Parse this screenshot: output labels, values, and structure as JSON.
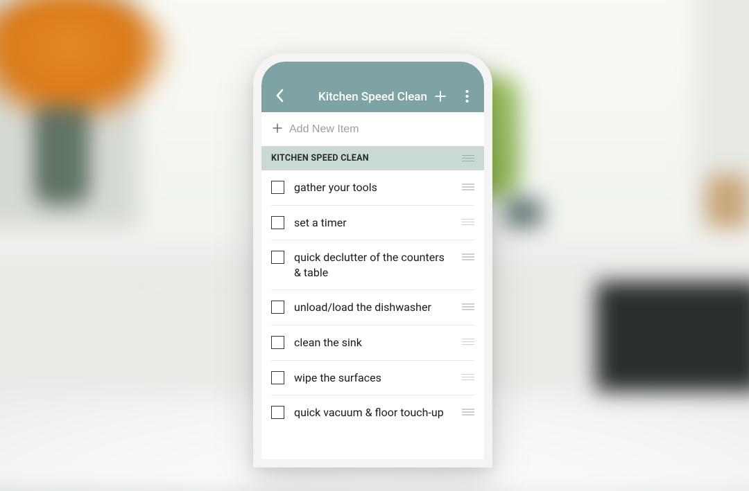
{
  "header": {
    "title": "Kitchen Speed Clean"
  },
  "addItem": {
    "placeholder": "Add New Item"
  },
  "section": {
    "title": "KITCHEN SPEED CLEAN"
  },
  "items": [
    {
      "label": "gather your tools"
    },
    {
      "label": "set a timer"
    },
    {
      "label": "quick declutter of the counters & table"
    },
    {
      "label": "unload/load the dishwasher"
    },
    {
      "label": "clean the sink"
    },
    {
      "label": "wipe the surfaces"
    },
    {
      "label": "quick vacuum & floor touch-up"
    }
  ]
}
